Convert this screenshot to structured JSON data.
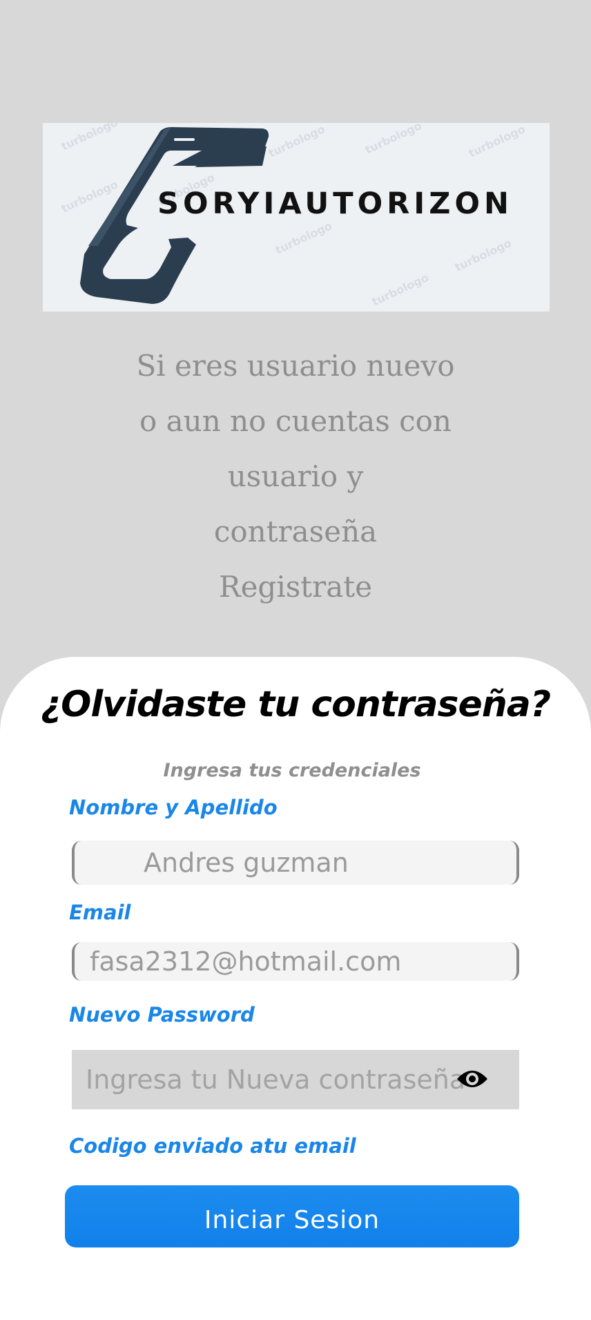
{
  "logo": {
    "text": "SORYIAUTORIZON",
    "watermark": "turbologo"
  },
  "intro": {
    "lines": [
      "Si eres usuario nuevo",
      "o aun no cuentas con",
      "usuario y",
      "contraseña",
      "Registrate"
    ]
  },
  "form": {
    "title": "¿Olvidaste tu contraseña?",
    "subtitle": "Ingresa tus credenciales",
    "name_label": "Nombre y Apellido",
    "name_value": "Andres guzman",
    "email_label": "Email",
    "email_value": "fasa2312@hotmail.com",
    "password_label": "Nuevo Password",
    "password_placeholder": "Ingresa tu Nueva contraseña",
    "code_label": "Codigo enviado atu email",
    "submit_label": "Iniciar Sesion"
  },
  "colors": {
    "background": "#d8d8d8",
    "accent": "#1a86e8",
    "button": "#1784ec",
    "logo_dark": "#2b3e50"
  },
  "icons": {
    "password_toggle": "eye-icon",
    "logo": "smartphone-icon"
  }
}
